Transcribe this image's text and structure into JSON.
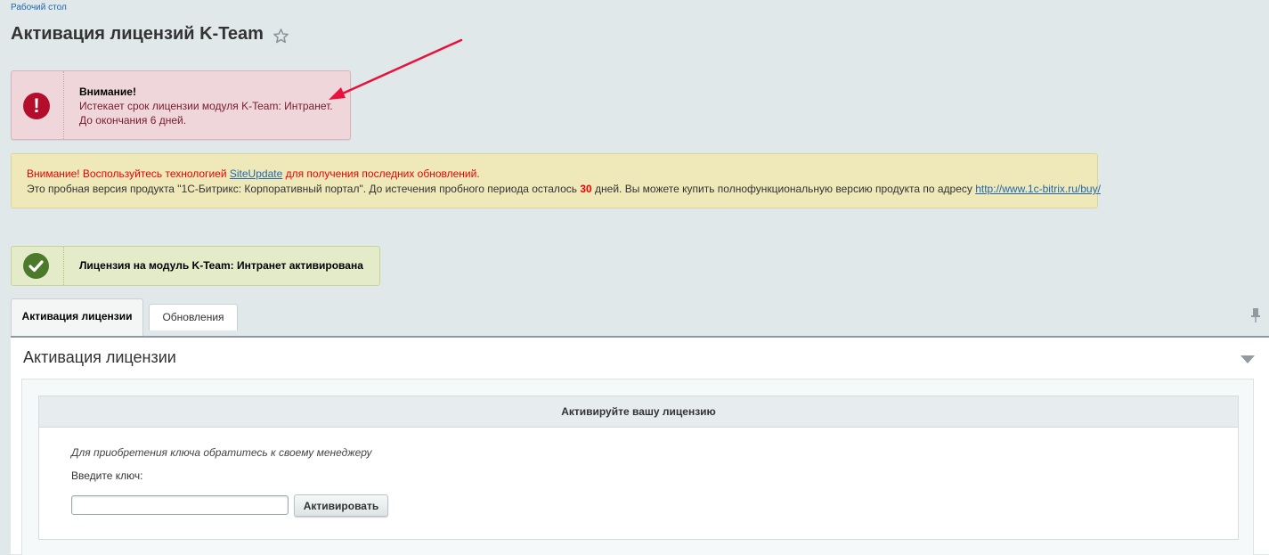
{
  "breadcrumb": "Рабочий стол",
  "page_title": "Активация лицензий K-Team",
  "alert_error": {
    "title": "Внимание!",
    "line1": "Истекает срок лицензии модуля K-Team: Интранет.",
    "line2": "До окончания 6 дней."
  },
  "notice": {
    "line1_prefix": "Внимание! Воспользуйтесь технологией ",
    "line1_link": "SiteUpdate",
    "line1_suffix": " для получения последних обновлений.",
    "line2_prefix": "Это пробная версия продукта \"1С-Битрикс: Корпоративный портал\". До истечения пробного периода осталось ",
    "line2_days": "30",
    "line2_middle": " дней. Вы можете купить полнофункциональную версию продукта по адресу ",
    "line2_link": "http://www.1c-bitrix.ru/buy/"
  },
  "alert_success": {
    "text": "Лицензия на модуль K-Team: Интранет активирована"
  },
  "tabs": [
    {
      "label": "Активация лицензии",
      "active": true
    },
    {
      "label": "Обновления",
      "active": false
    }
  ],
  "section": {
    "title": "Активация лицензии",
    "box_header": "Активируйте вашу лицензию",
    "hint": "Для приобретения ключа обратитесь к своему менеджеру",
    "key_label": "Введите ключ:",
    "key_value": "",
    "button_label": "Активировать"
  },
  "colors": {
    "background": "#e1e8ea",
    "error_red": "#b30e2c",
    "success_green": "#4a7a2a",
    "annotation_arrow": "#e8123c",
    "link": "#2067b0"
  },
  "icons": {
    "favorite": "star-icon",
    "error": "exclamation-icon",
    "success": "checkmark-icon",
    "pin": "pin-icon",
    "collapse": "triangle-down-icon"
  }
}
